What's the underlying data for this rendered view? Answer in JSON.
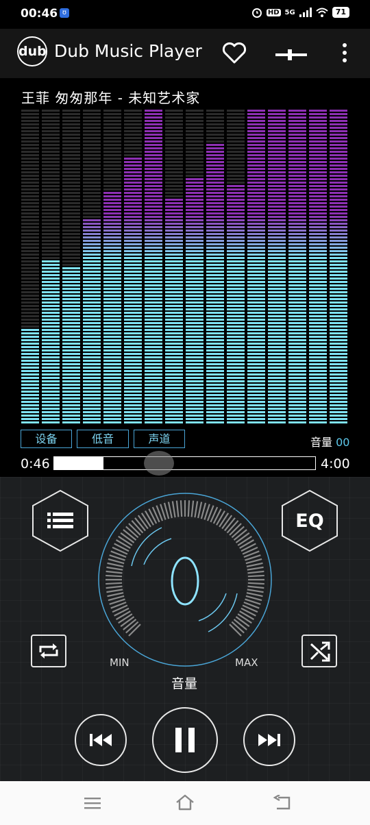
{
  "status_bar": {
    "time": "00:46",
    "battery": "71",
    "network": "5G",
    "hd": "HD"
  },
  "app": {
    "logo_text": "dub",
    "title": "Dub Music Player"
  },
  "now_playing": {
    "title": "王菲  匆匆那年  -  未知艺术家"
  },
  "visualizer": {
    "levels": [
      0.3,
      0.52,
      0.5,
      0.65,
      0.74,
      0.85,
      1.0,
      0.72,
      0.78,
      0.89,
      0.76,
      1.0,
      1.0,
      1.0,
      1.0,
      1.0
    ],
    "colors": {
      "low": "#7fe3f5",
      "high": "#8e30b4",
      "off": "#2b2b2b"
    }
  },
  "controls": {
    "device_label": "设备",
    "bass_label": "低音",
    "channel_label": "声道",
    "volume_label": "音量",
    "volume_value": "00"
  },
  "progress": {
    "current": "0:46",
    "total": "4:00",
    "fraction": 0.19
  },
  "knob": {
    "min_label": "MIN",
    "max_label": "MAX",
    "title": "音量",
    "value": 0
  },
  "buttons": {
    "eq_label": "EQ"
  },
  "icons": {
    "menu": "menu-icon",
    "repeat": "repeat-icon",
    "shuffle": "shuffle-icon",
    "prev": "previous-icon",
    "pause": "pause-icon",
    "next": "next-icon",
    "heart": "heart-icon",
    "connect": "connect-icon",
    "more": "more-icon",
    "home": "home-icon",
    "back": "back-icon"
  }
}
